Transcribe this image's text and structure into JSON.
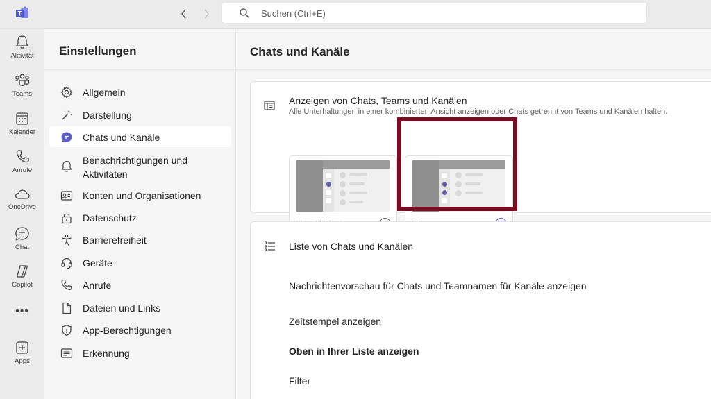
{
  "topbar": {
    "search_placeholder": "Suchen (Ctrl+E)",
    "back_icon": "chevron-left-icon",
    "forward_icon": "chevron-right-icon"
  },
  "rail": {
    "items": [
      {
        "label": "Aktivität",
        "icon": "bell-icon"
      },
      {
        "label": "Teams",
        "icon": "teams-icon"
      },
      {
        "label": "Kalender",
        "icon": "calendar-icon"
      },
      {
        "label": "Anrufe",
        "icon": "phone-icon"
      },
      {
        "label": "OneDrive",
        "icon": "cloud-icon"
      },
      {
        "label": "Chat",
        "icon": "chat-icon"
      },
      {
        "label": "Copilot",
        "icon": "copilot-icon"
      },
      {
        "label": "Apps",
        "icon": "add-app-icon"
      }
    ],
    "more": "•••"
  },
  "settings": {
    "title": "Einstellungen",
    "items": [
      {
        "label": "Allgemein",
        "icon": "gear-icon"
      },
      {
        "label": "Darstellung",
        "icon": "magic-wand-icon"
      },
      {
        "label": "Chats und Kanäle",
        "icon": "chat-bubble-icon",
        "active": true
      },
      {
        "label": "Benachrichtigungen und Aktivitäten",
        "icon": "bell-icon"
      },
      {
        "label": "Konten und Organisationen",
        "icon": "contact-card-icon"
      },
      {
        "label": "Datenschutz",
        "icon": "lock-icon"
      },
      {
        "label": "Barrierefreiheit",
        "icon": "accessibility-icon"
      },
      {
        "label": "Geräte",
        "icon": "headset-icon"
      },
      {
        "label": "Anrufe",
        "icon": "phone-icon"
      },
      {
        "label": "Dateien und Links",
        "icon": "document-icon"
      },
      {
        "label": "App-Berechtigungen",
        "icon": "shield-icon"
      },
      {
        "label": "Erkennung",
        "icon": "recognition-icon"
      }
    ]
  },
  "main": {
    "title": "Chats und Kanäle",
    "display_section": {
      "title": "Anzeigen von Chats, Teams und Kanälen",
      "subtitle": "Alle Unterhaltungen in einer kombinierten Ansicht anzeigen oder Chats getrennt von Teams und Kanälen halten.",
      "options": [
        {
          "label": "Kombiniert",
          "selected": false
        },
        {
          "label": "Trennen",
          "selected": true
        }
      ],
      "highlight_color": "#7a0d24"
    },
    "list_section": {
      "title": "Liste von Chats und Kanälen",
      "rows": [
        "Nachrichtenvorschau für Chats und Teamnamen für Kanäle anzeigen",
        "Zeitstempel anzeigen",
        "Oben in Ihrer Liste anzeigen",
        "Filter"
      ]
    }
  },
  "colors": {
    "accent": "#5b5fc7",
    "highlight": "#7a0d24"
  }
}
